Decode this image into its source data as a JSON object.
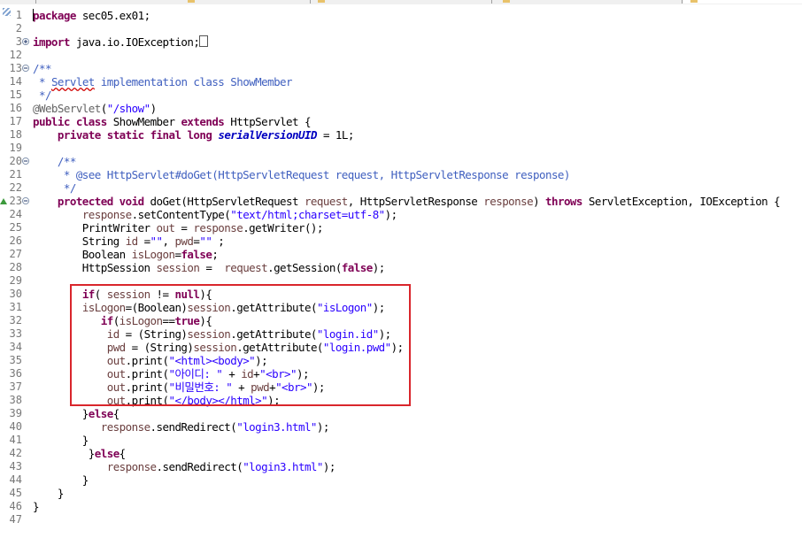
{
  "lines": [
    {
      "n": "1",
      "s": [
        [
          "package",
          "kw"
        ],
        [
          " sec05.ex01;",
          ""
        ]
      ]
    },
    {
      "n": "2",
      "s": []
    },
    {
      "n": "3",
      "fold": "plus",
      "s": [
        [
          "import",
          "kw"
        ],
        [
          " java.io.IOException;",
          ""
        ]
      ],
      "collapsed": true
    },
    {
      "n": "12",
      "s": []
    },
    {
      "n": "13",
      "fold": "minus",
      "s": [
        [
          "/**",
          "cmt"
        ]
      ]
    },
    {
      "n": "14",
      "s": [
        [
          " * ",
          "cmt"
        ],
        [
          "Servlet",
          "cmt squig"
        ],
        [
          " implementation class ShowMember",
          "cmt"
        ]
      ]
    },
    {
      "n": "15",
      "s": [
        [
          " */",
          "cmt"
        ]
      ]
    },
    {
      "n": "16",
      "s": [
        [
          "@WebServlet",
          "ann"
        ],
        [
          "(",
          ""
        ],
        [
          "\"/show\"",
          "str"
        ],
        [
          ")",
          ""
        ]
      ]
    },
    {
      "n": "17",
      "s": [
        [
          "public",
          "kw"
        ],
        [
          " ",
          ""
        ],
        [
          "class",
          "kw"
        ],
        [
          " ShowMember ",
          ""
        ],
        [
          "extends",
          "kw"
        ],
        [
          " HttpServlet {",
          ""
        ]
      ]
    },
    {
      "n": "18",
      "s": [
        [
          "    ",
          ""
        ],
        [
          "private",
          "kw"
        ],
        [
          " ",
          ""
        ],
        [
          "static",
          "kw"
        ],
        [
          " ",
          ""
        ],
        [
          "final",
          "kw"
        ],
        [
          " ",
          ""
        ],
        [
          "long",
          "kw"
        ],
        [
          " ",
          ""
        ],
        [
          "serialVersionUID",
          "fld"
        ],
        [
          " = 1L;",
          ""
        ]
      ]
    },
    {
      "n": "19",
      "s": []
    },
    {
      "n": "20",
      "fold": "minus",
      "s": [
        [
          "    /**",
          "cmt"
        ]
      ]
    },
    {
      "n": "21",
      "s": [
        [
          "     * @see HttpServlet#doGet(HttpServletRequest request, HttpServletResponse response)",
          "cmt"
        ]
      ]
    },
    {
      "n": "22",
      "s": [
        [
          "     */",
          "cmt"
        ]
      ]
    },
    {
      "n": "23",
      "fold": "minus",
      "override": true,
      "s": [
        [
          "    ",
          ""
        ],
        [
          "protected",
          "kw"
        ],
        [
          " ",
          ""
        ],
        [
          "void",
          "kw"
        ],
        [
          " doGet(HttpServletRequest ",
          ""
        ],
        [
          "request",
          "var"
        ],
        [
          ", HttpServletResponse ",
          ""
        ],
        [
          "response",
          "var"
        ],
        [
          ") ",
          ""
        ],
        [
          "throws",
          "kw"
        ],
        [
          " ServletException, IOException {",
          ""
        ]
      ]
    },
    {
      "n": "24",
      "s": [
        [
          "        ",
          ""
        ],
        [
          "response",
          "var"
        ],
        [
          ".setContentType(",
          ""
        ],
        [
          "\"text/html;charset=utf-8\"",
          "str"
        ],
        [
          ");",
          ""
        ]
      ]
    },
    {
      "n": "25",
      "s": [
        [
          "        PrintWriter ",
          ""
        ],
        [
          "out",
          "var"
        ],
        [
          " = ",
          ""
        ],
        [
          "response",
          "var"
        ],
        [
          ".getWriter();",
          ""
        ]
      ]
    },
    {
      "n": "26",
      "s": [
        [
          "        String ",
          ""
        ],
        [
          "id",
          "var"
        ],
        [
          " =",
          ""
        ],
        [
          "\"\"",
          "str"
        ],
        [
          ", ",
          ""
        ],
        [
          "pwd",
          "var"
        ],
        [
          "=",
          ""
        ],
        [
          "\"\"",
          "str"
        ],
        [
          " ;",
          ""
        ]
      ]
    },
    {
      "n": "27",
      "s": [
        [
          "        Boolean ",
          ""
        ],
        [
          "isLogon",
          "var"
        ],
        [
          "=",
          ""
        ],
        [
          "false",
          "kw"
        ],
        [
          ";",
          ""
        ]
      ]
    },
    {
      "n": "28",
      "s": [
        [
          "        HttpSession ",
          ""
        ],
        [
          "session",
          "var"
        ],
        [
          " =  ",
          ""
        ],
        [
          "request",
          "var"
        ],
        [
          ".getSession(",
          ""
        ],
        [
          "false",
          "kw"
        ],
        [
          ");",
          ""
        ]
      ]
    },
    {
      "n": "29",
      "s": []
    },
    {
      "n": "30",
      "s": [
        [
          "        ",
          ""
        ],
        [
          "if",
          "kw"
        ],
        [
          "( ",
          ""
        ],
        [
          "session",
          "var"
        ],
        [
          " != ",
          ""
        ],
        [
          "null",
          "kw"
        ],
        [
          "){",
          ""
        ]
      ]
    },
    {
      "n": "31",
      "s": [
        [
          "        ",
          ""
        ],
        [
          "isLogon",
          "var"
        ],
        [
          "=(Boolean)",
          ""
        ],
        [
          "session",
          "var"
        ],
        [
          ".getAttribute(",
          ""
        ],
        [
          "\"isLogon\"",
          "str"
        ],
        [
          ");",
          ""
        ]
      ]
    },
    {
      "n": "32",
      "s": [
        [
          "           ",
          ""
        ],
        [
          "if",
          "kw"
        ],
        [
          "(",
          ""
        ],
        [
          "isLogon",
          "var"
        ],
        [
          "==",
          ""
        ],
        [
          "true",
          "kw"
        ],
        [
          "){",
          ""
        ]
      ]
    },
    {
      "n": "33",
      "s": [
        [
          "            ",
          ""
        ],
        [
          "id",
          "var"
        ],
        [
          " = (String)",
          ""
        ],
        [
          "session",
          "var"
        ],
        [
          ".getAttribute(",
          ""
        ],
        [
          "\"login.id\"",
          "str"
        ],
        [
          ");",
          ""
        ]
      ]
    },
    {
      "n": "34",
      "s": [
        [
          "            ",
          ""
        ],
        [
          "pwd",
          "var"
        ],
        [
          " = (String)",
          ""
        ],
        [
          "session",
          "var"
        ],
        [
          ".getAttribute(",
          ""
        ],
        [
          "\"login.pwd\"",
          "str"
        ],
        [
          ");",
          ""
        ]
      ]
    },
    {
      "n": "35",
      "s": [
        [
          "            ",
          ""
        ],
        [
          "out",
          "var"
        ],
        [
          ".print(",
          ""
        ],
        [
          "\"<html><body>\"",
          "str"
        ],
        [
          ");",
          ""
        ]
      ]
    },
    {
      "n": "36",
      "s": [
        [
          "            ",
          ""
        ],
        [
          "out",
          "var"
        ],
        [
          ".print(",
          ""
        ],
        [
          "\"아이디: \"",
          "str"
        ],
        [
          " + ",
          ""
        ],
        [
          "id",
          "var"
        ],
        [
          "+",
          ""
        ],
        [
          "\"<br>\"",
          "str"
        ],
        [
          ");",
          ""
        ]
      ]
    },
    {
      "n": "37",
      "s": [
        [
          "            ",
          ""
        ],
        [
          "out",
          "var"
        ],
        [
          ".print(",
          ""
        ],
        [
          "\"비밀번호: \"",
          "str"
        ],
        [
          " + ",
          ""
        ],
        [
          "pwd",
          "var"
        ],
        [
          "+",
          ""
        ],
        [
          "\"<br>\"",
          "str"
        ],
        [
          ");",
          ""
        ]
      ]
    },
    {
      "n": "38",
      "s": [
        [
          "            ",
          ""
        ],
        [
          "out",
          "var"
        ],
        [
          ".print(",
          ""
        ],
        [
          "\"</body></html>\"",
          "str"
        ],
        [
          ");",
          ""
        ]
      ]
    },
    {
      "n": "39",
      "s": [
        [
          "        }",
          ""
        ],
        [
          "else",
          "kw"
        ],
        [
          "{",
          ""
        ]
      ]
    },
    {
      "n": "40",
      "s": [
        [
          "           ",
          ""
        ],
        [
          "response",
          "var"
        ],
        [
          ".sendRedirect(",
          ""
        ],
        [
          "\"login3.html\"",
          "str"
        ],
        [
          ");",
          ""
        ]
      ]
    },
    {
      "n": "41",
      "s": [
        [
          "        }",
          ""
        ]
      ]
    },
    {
      "n": "42",
      "s": [
        [
          "         }",
          ""
        ],
        [
          "else",
          "kw"
        ],
        [
          "{",
          ""
        ]
      ]
    },
    {
      "n": "43",
      "s": [
        [
          "            ",
          ""
        ],
        [
          "response",
          "var"
        ],
        [
          ".sendRedirect(",
          ""
        ],
        [
          "\"login3.html\"",
          "str"
        ],
        [
          ");",
          ""
        ]
      ]
    },
    {
      "n": "44",
      "s": [
        [
          "        }",
          ""
        ]
      ]
    },
    {
      "n": "45",
      "s": [
        [
          "    }",
          ""
        ]
      ]
    },
    {
      "n": "46",
      "s": [
        [
          "}",
          ""
        ]
      ]
    },
    {
      "n": "47",
      "s": []
    }
  ],
  "colors": {
    "keyword": "#7f0055",
    "string": "#2a00ff",
    "comment": "#3f5fbf",
    "highlight_box": "#d9262c"
  }
}
